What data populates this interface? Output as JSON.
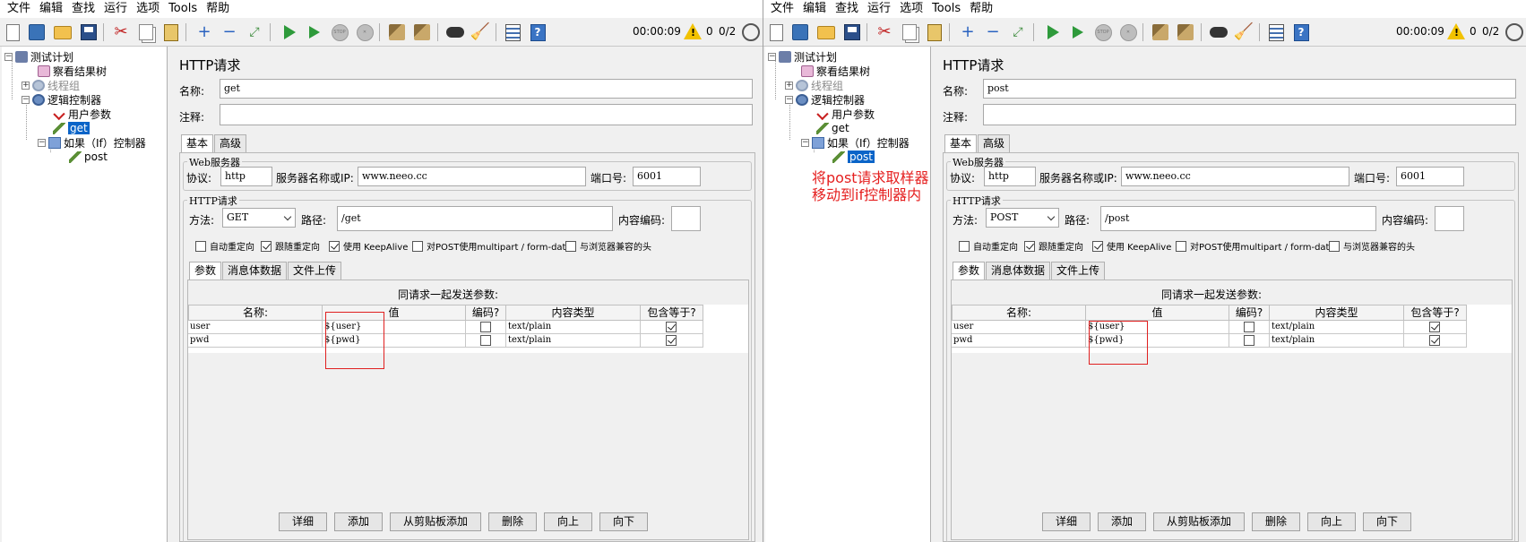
{
  "menu": [
    "文件",
    "编辑",
    "查找",
    "运行",
    "选项",
    "Tools",
    "帮助"
  ],
  "toolbar_status": {
    "timer": "00:00:09",
    "warnings": "0",
    "threads": "0/2"
  },
  "tree": {
    "test_plan": "测试计划",
    "result_tree": "察看结果树",
    "thread_group": "线程组",
    "logic_controller": "逻辑控制器",
    "user_params": "用户参数",
    "get": "get",
    "if_controller": "如果（If）控制器",
    "post": "post"
  },
  "annotation": [
    "将post请求取样器",
    "移动到if控制器内"
  ],
  "labels": {
    "title": "HTTP请求",
    "name": "名称:",
    "comment": "注释:",
    "tab_basic": "基本",
    "tab_advanced": "高级",
    "web_server": "Web服务器",
    "protocol": "协议:",
    "server": "服务器名称或IP:",
    "port": "端口号:",
    "http_request": "HTTP请求",
    "method": "方法:",
    "path": "路径:",
    "encoding": "内容编码:",
    "cb_redirect_auto": "自动重定向",
    "cb_follow_redirect": "跟随重定向",
    "cb_keepalive": "使用 KeepAlive",
    "cb_multipart": "对POST使用multipart / form-data",
    "cb_browser_headers": "与浏览器兼容的头",
    "tab_params": "参数",
    "tab_body": "消息体数据",
    "tab_files": "文件上传",
    "send_params": "同请求一起发送参数:",
    "col_name": "名称:",
    "col_value": "值",
    "col_encode": "编码?",
    "col_type": "内容类型",
    "col_include": "包含等于?"
  },
  "buttons": [
    "详细",
    "添加",
    "从剪贴板添加",
    "删除",
    "向上",
    "向下"
  ],
  "left": {
    "name_value": "get",
    "protocol_value": "http",
    "server_value": "www.neeo.cc",
    "port_value": "6001",
    "method_value": "GET",
    "path_value": "/get",
    "checks": {
      "cb_redirect_auto": false,
      "cb_follow_redirect": true,
      "cb_keepalive": true,
      "cb_multipart": false,
      "cb_browser_headers": false
    },
    "params": [
      {
        "name": "user",
        "value": "${user}",
        "encode": false,
        "type": "text/plain",
        "include": true
      },
      {
        "name": "pwd",
        "value": "${pwd}",
        "encode": false,
        "type": "text/plain",
        "include": true
      }
    ]
  },
  "right": {
    "name_value": "post",
    "protocol_value": "http",
    "server_value": "www.neeo.cc",
    "port_value": "6001",
    "method_value": "POST",
    "path_value": "/post",
    "checks": {
      "cb_redirect_auto": false,
      "cb_follow_redirect": true,
      "cb_keepalive": true,
      "cb_multipart": false,
      "cb_browser_headers": false
    },
    "params": [
      {
        "name": "user",
        "value": "${user}",
        "encode": false,
        "type": "text/plain",
        "include": true
      },
      {
        "name": "pwd",
        "value": "${pwd}",
        "encode": false,
        "type": "text/plain",
        "include": true
      }
    ]
  },
  "colors": {
    "selection": "#0a64c8",
    "annotation": "#e52020",
    "highlight_box": "#e02020"
  }
}
